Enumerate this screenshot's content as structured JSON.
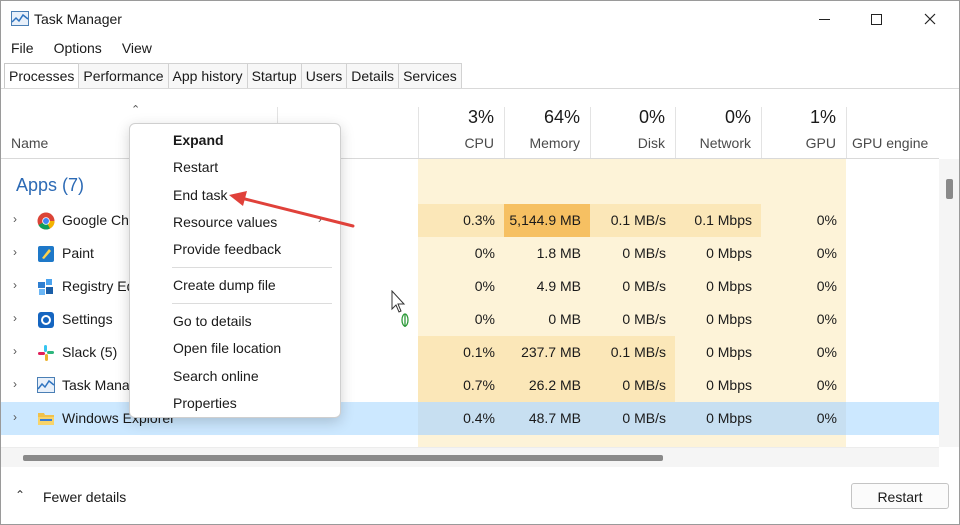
{
  "window": {
    "title": "Task Manager"
  },
  "menubar": [
    "File",
    "Options",
    "View"
  ],
  "tabs": [
    "Processes",
    "Performance",
    "App history",
    "Startup",
    "Users",
    "Details",
    "Services"
  ],
  "header": {
    "name_label": "Name",
    "columns": [
      {
        "pct": "3%",
        "label": "CPU"
      },
      {
        "pct": "64%",
        "label": "Memory"
      },
      {
        "pct": "0%",
        "label": "Disk"
      },
      {
        "pct": "0%",
        "label": "Network"
      },
      {
        "pct": "1%",
        "label": "GPU"
      },
      {
        "pct": "",
        "label": "GPU engine"
      }
    ]
  },
  "group_label": "Apps (7)",
  "rows": [
    {
      "name": "Google Chrome (26)",
      "icon": "chrome-icon",
      "cpu": "0.3%",
      "memory": "5,144.9 MB",
      "disk": "0.1 MB/s",
      "network": "0.1 Mbps",
      "gpu": "0%"
    },
    {
      "name": "Paint",
      "icon": "paint-icon",
      "cpu": "0%",
      "memory": "1.8 MB",
      "disk": "0 MB/s",
      "network": "0 Mbps",
      "gpu": "0%"
    },
    {
      "name": "Registry Editor",
      "icon": "registry-icon",
      "cpu": "0%",
      "memory": "4.9 MB",
      "disk": "0 MB/s",
      "network": "0 Mbps",
      "gpu": "0%"
    },
    {
      "name": "Settings",
      "icon": "settings-icon",
      "cpu": "0%",
      "memory": "0 MB",
      "disk": "0 MB/s",
      "network": "0 Mbps",
      "gpu": "0%"
    },
    {
      "name": "Slack (5)",
      "icon": "slack-icon",
      "cpu": "0.1%",
      "memory": "237.7 MB",
      "disk": "0.1 MB/s",
      "network": "0 Mbps",
      "gpu": "0%"
    },
    {
      "name": "Task Manager",
      "icon": "task-manager-icon",
      "cpu": "0.7%",
      "memory": "26.2 MB",
      "disk": "0 MB/s",
      "network": "0 Mbps",
      "gpu": "0%"
    },
    {
      "name": "Windows Explorer",
      "icon": "folder-icon",
      "cpu": "0.4%",
      "memory": "48.7 MB",
      "disk": "0 MB/s",
      "network": "0 Mbps",
      "gpu": "0%"
    }
  ],
  "context_menu": {
    "items": [
      "Expand",
      "Restart",
      "End task",
      "Resource values",
      "Provide feedback",
      "Create dump file",
      "Go to details",
      "Open file location",
      "Search online",
      "Properties"
    ]
  },
  "footer": {
    "fewer_details": "Fewer details",
    "restart_button": "Restart"
  },
  "colors": {
    "accent_blue": "#2c6ab5",
    "heat_light": "#fbe7b8",
    "heat_hot": "#f6c062",
    "selection": "#cce8ff",
    "annotation_arrow": "#e0413a"
  }
}
